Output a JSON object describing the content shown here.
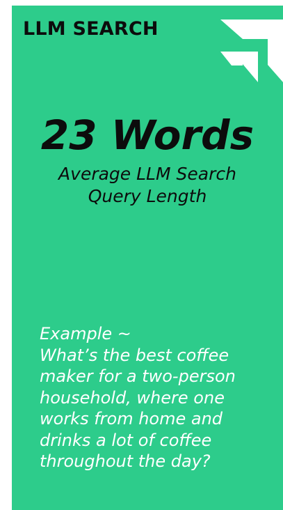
{
  "brand": {
    "title": "LLM SEARCH",
    "logo_icon": "arrow-up-right-icon"
  },
  "stat": {
    "value": "23 Words",
    "caption": "Average LLM Search Query Length"
  },
  "example": {
    "label": "Example ~",
    "text": "What’s the best coffee maker for a two-person household, where one works from home and drinks a lot of coffee throughout the day?"
  },
  "colors": {
    "background": "#2dcc8b",
    "dark_text": "#0c0c0c",
    "light_text": "#ffffff"
  }
}
